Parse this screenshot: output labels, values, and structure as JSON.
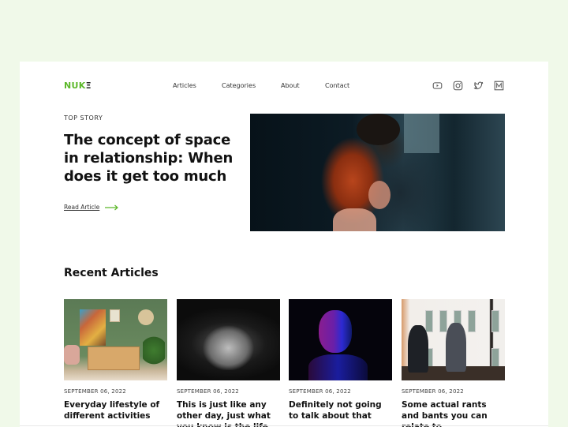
{
  "brand": {
    "logo_main": "NUK",
    "logo_last": "Ξ",
    "accent_color": "#5cb82a",
    "background_color": "#f0f9e9"
  },
  "nav": {
    "items": [
      {
        "label": "Articles"
      },
      {
        "label": "Categories"
      },
      {
        "label": "About"
      },
      {
        "label": "Contact"
      }
    ]
  },
  "social": {
    "icons": [
      "youtube-icon",
      "instagram-icon",
      "twitter-icon",
      "medium-icon"
    ]
  },
  "hero": {
    "eyebrow": "TOP STORY",
    "title": "The concept of space in relationship: When does it get too much",
    "link_label": "Read Article",
    "image_alt": "Couple embracing in a dark street"
  },
  "recent": {
    "heading": "Recent Articles",
    "articles": [
      {
        "date": "SEPTEMBER 06, 2022",
        "title": "Everyday lifestyle of different activities",
        "image_alt": "Living room with green wall and art"
      },
      {
        "date": "SEPTEMBER 06, 2022",
        "title": "This is just like any other day, just what you know is the life",
        "image_alt": "Black and white figure with hands together"
      },
      {
        "date": "SEPTEMBER 06, 2022",
        "title": "Definitely not going to talk about that",
        "image_alt": "Man in neon light with finger on lips"
      },
      {
        "date": "SEPTEMBER 06, 2022",
        "title": "Some actual rants and bants you can relate to",
        "image_alt": "Two women talking by a window"
      }
    ]
  }
}
